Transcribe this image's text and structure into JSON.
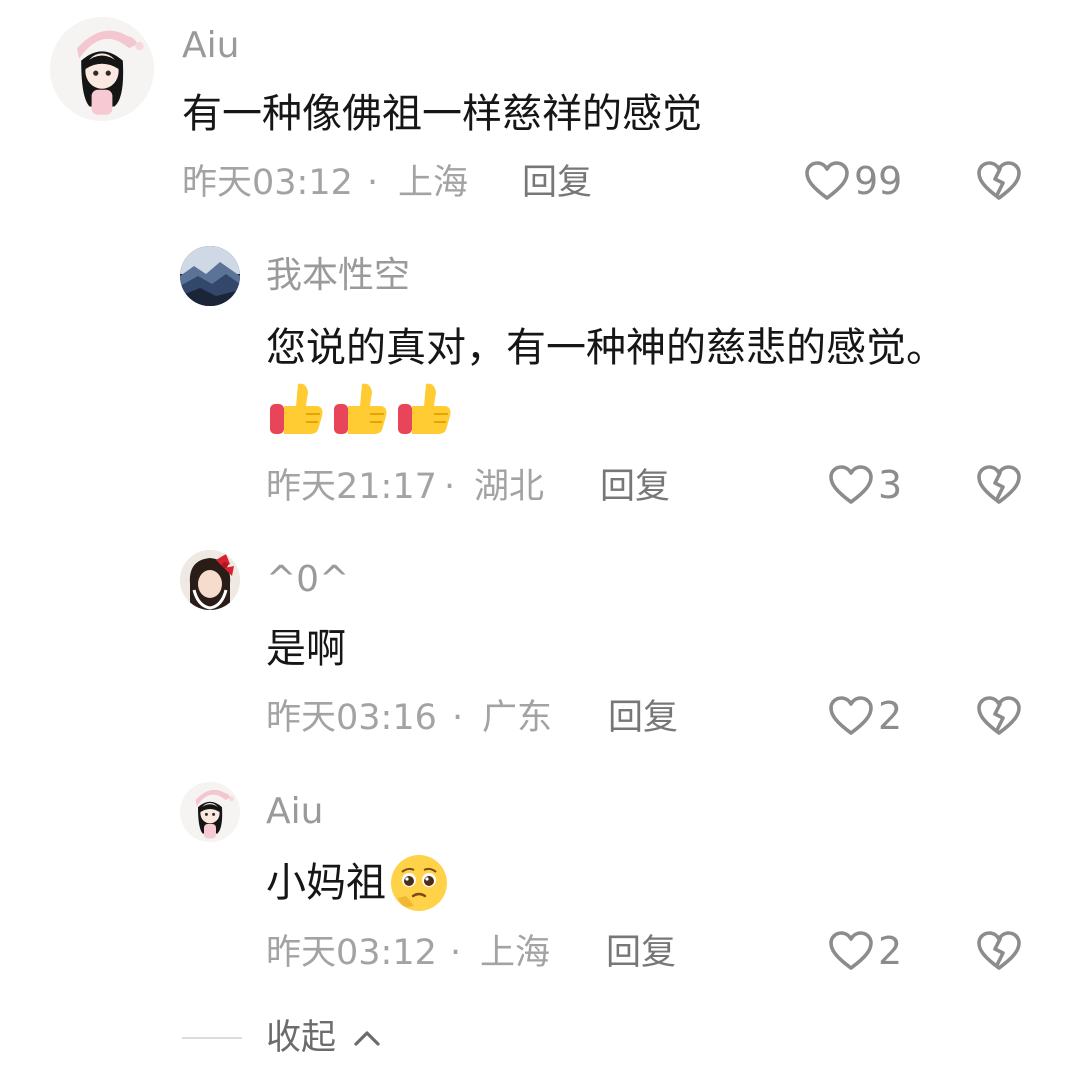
{
  "comments": [
    {
      "username": "Aiu",
      "text": "有一种像佛祖一样慈祥的感觉",
      "time": "昨天03:12",
      "separator": "·",
      "location": "上海",
      "reply_label": "回复",
      "likes": "99"
    },
    {
      "username": "我本性空",
      "text": "您说的真对，有一种神的慈悲的感觉。",
      "emoji": "thumbs-up-x3",
      "time": "昨天21:17",
      "separator": "·",
      "location": "湖北",
      "reply_label": "回复",
      "likes": "3"
    },
    {
      "username": "^0^",
      "text": "是啊",
      "time": "昨天03:16",
      "separator": "·",
      "location": "广东",
      "reply_label": "回复",
      "likes": "2"
    },
    {
      "username": "Aiu",
      "text": "小妈祖",
      "emoji": "pleading-face",
      "time": "昨天03:12",
      "separator": "·",
      "location": "上海",
      "reply_label": "回复",
      "likes": "2"
    }
  ],
  "collapse_label": "收起",
  "icons": {
    "like": "heart-outline-icon",
    "dislike": "broken-heart-icon",
    "collapse": "chevron-up-icon"
  },
  "colors": {
    "username": "#9a9a9a",
    "text": "#161616",
    "meta": "#a3a3a3",
    "icon": "#8c8c8c"
  }
}
